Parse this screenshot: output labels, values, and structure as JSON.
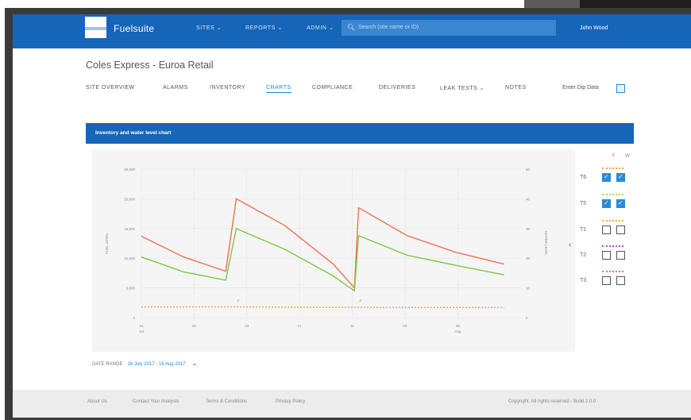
{
  "header": {
    "brand": "Fuelsuite",
    "nav": [
      {
        "label": "SITES ⌄",
        "active": true
      },
      {
        "label": "REPORTS ⌄",
        "active": false
      },
      {
        "label": "ADMIN ⌄",
        "active": false
      }
    ],
    "search_placeholder": "Search (site name or ID)",
    "user": "John Wood"
  },
  "page": {
    "site_title": "Coles Express - Euroa Retail",
    "tabs": [
      {
        "label": "SITE OVERVIEW",
        "active": false
      },
      {
        "label": "ALARMS",
        "active": false
      },
      {
        "label": "INVENTORY",
        "active": false
      },
      {
        "label": "CHARTS",
        "active": true
      },
      {
        "label": "COMPLIANCE",
        "active": false
      },
      {
        "label": "DELIVERIES",
        "active": false
      },
      {
        "label": "LEAK TESTS ⌄",
        "active": false
      },
      {
        "label": "NOTES",
        "active": false
      }
    ],
    "enter_dip_label": "Enter Dip Data",
    "panel_title": "Inventory and water level chart",
    "date_range_label": "DATE RANGE",
    "date_range_value": "16 July 2017 - 16 Aug 2017"
  },
  "chart_data": {
    "type": "line",
    "ylabel": "FUEL LEVEL",
    "y2label": "WATER LEVEL",
    "y_ticks": [
      "0",
      "5,000",
      "10,000",
      "15,000",
      "20,000",
      "25,000"
    ],
    "y2_ticks": [
      "0",
      "10",
      "20",
      "30",
      "40",
      "50"
    ],
    "x_ticks": [
      {
        "label": "16",
        "sub": "Jul"
      },
      {
        "label": "20",
        "sub": ""
      },
      {
        "label": "23",
        "sub": ""
      },
      {
        "label": "27",
        "sub": ""
      },
      {
        "label": "31",
        "sub": ""
      },
      {
        "label": "03",
        "sub": ""
      },
      {
        "label": "06",
        "sub": "Aug"
      }
    ],
    "ylim": [
      0,
      25000
    ],
    "y2lim": [
      0,
      50
    ],
    "series": [
      {
        "name": "T6",
        "color": "#f07050",
        "points": [
          [
            0,
            13700
          ],
          [
            1,
            10200
          ],
          [
            2,
            7800
          ],
          [
            2.25,
            20000
          ],
          [
            3.4,
            15500
          ],
          [
            4.55,
            9000
          ],
          [
            5.05,
            5000
          ],
          [
            5.15,
            18500
          ],
          [
            6.3,
            13800
          ],
          [
            7.45,
            11000
          ],
          [
            8.6,
            9000
          ]
        ]
      },
      {
        "name": "T5",
        "color": "#7ec840",
        "points": [
          [
            0,
            10200
          ],
          [
            1,
            7700
          ],
          [
            2,
            6300
          ],
          [
            2.25,
            15000
          ],
          [
            3.4,
            11500
          ],
          [
            4.55,
            7000
          ],
          [
            5.05,
            4500
          ],
          [
            5.15,
            13800
          ],
          [
            6.3,
            10500
          ],
          [
            7.45,
            8800
          ],
          [
            8.6,
            7200
          ]
        ]
      },
      {
        "name": "water",
        "color": "#e8a838",
        "points": [
          [
            0,
            1800
          ],
          [
            2.25,
            1800
          ],
          [
            5.15,
            1700
          ],
          [
            8.6,
            1700
          ]
        ]
      }
    ],
    "marker_labels": [
      "P",
      "P"
    ]
  },
  "tanks_header": [
    "F",
    "W"
  ],
  "tanks": [
    {
      "name": "T6",
      "fuel": true,
      "water": true,
      "color": "#f0a050"
    },
    {
      "name": "T5",
      "fuel": true,
      "water": true,
      "color": "#b8d850"
    },
    {
      "name": "T1",
      "fuel": false,
      "water": false,
      "color": "#f0b040"
    },
    {
      "name": "T2",
      "fuel": false,
      "water": false,
      "color": "#c040d0"
    },
    {
      "name": "T3",
      "fuel": false,
      "water": false,
      "color": "#f07050"
    }
  ],
  "footer": {
    "links": [
      "About Us",
      "Contact Your Analysts",
      "Terms & Conditions",
      "Privacy Policy"
    ],
    "copyright": "Copyright. All rights reserved - Build 2.0.0"
  }
}
